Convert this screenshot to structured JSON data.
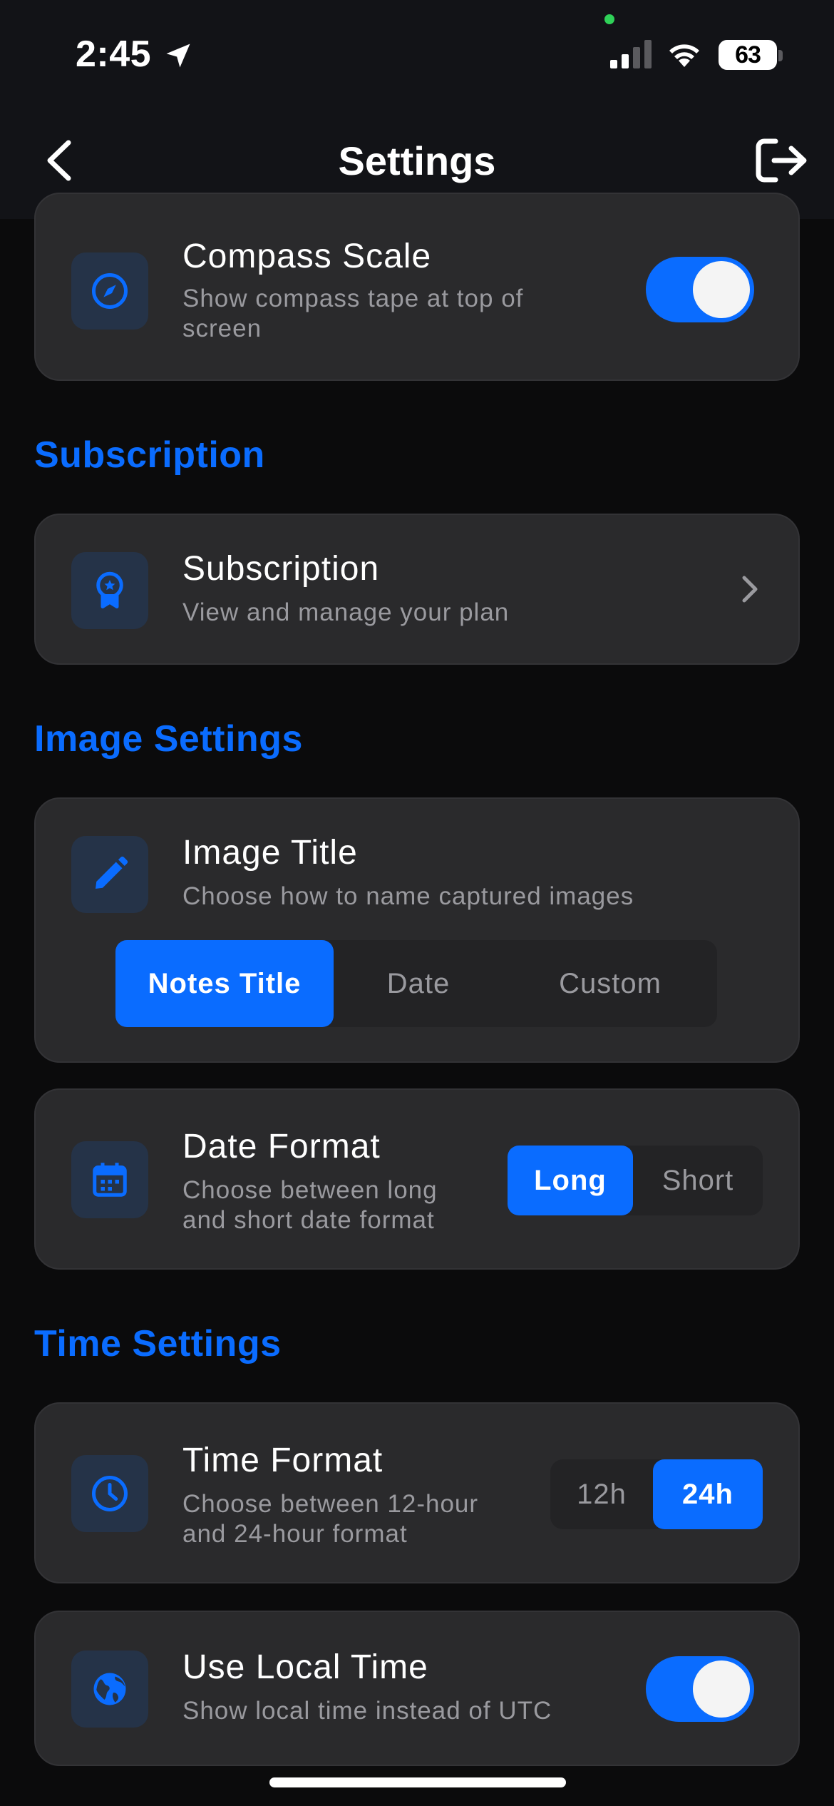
{
  "status_bar": {
    "time": "2:45",
    "battery": "63"
  },
  "header": {
    "title": "Settings"
  },
  "compass": {
    "title": "Compass Scale",
    "subtitle_line1": "Show compass tape at top of",
    "subtitle_line2": "screen",
    "enabled": true
  },
  "sections": {
    "subscription": "Subscription",
    "image": "Image Settings",
    "time": "Time Settings"
  },
  "subscription": {
    "title": "Subscription",
    "subtitle": "View and manage your plan"
  },
  "image_title": {
    "title": "Image Title",
    "subtitle": "Choose how to name captured images",
    "options": [
      "Notes Title",
      "Date",
      "Custom"
    ],
    "selected": "Notes Title"
  },
  "date_format": {
    "title": "Date Format",
    "subtitle_line1": "Choose between long",
    "subtitle_line2": "and short date format",
    "options": [
      "Long",
      "Short"
    ],
    "selected": "Long"
  },
  "time_format": {
    "title": "Time Format",
    "subtitle_line1": "Choose between 12-hour",
    "subtitle_line2": "and 24-hour format",
    "options": [
      "12h",
      "24h"
    ],
    "selected": "24h"
  },
  "local_time": {
    "title": "Use Local Time",
    "subtitle": "Show local time instead of UTC",
    "enabled": true
  },
  "colors": {
    "accent": "#0a6cff",
    "background": "#0b0b0c",
    "card": "#2a2a2c"
  },
  "icons": {
    "back": "chevron-left-icon",
    "logout": "logout-icon",
    "compass": "compass-icon",
    "subscription": "badge-icon",
    "image_title": "pencil-icon",
    "date_format": "calendar-icon",
    "time_format": "clock-icon",
    "local_time": "globe-icon"
  }
}
